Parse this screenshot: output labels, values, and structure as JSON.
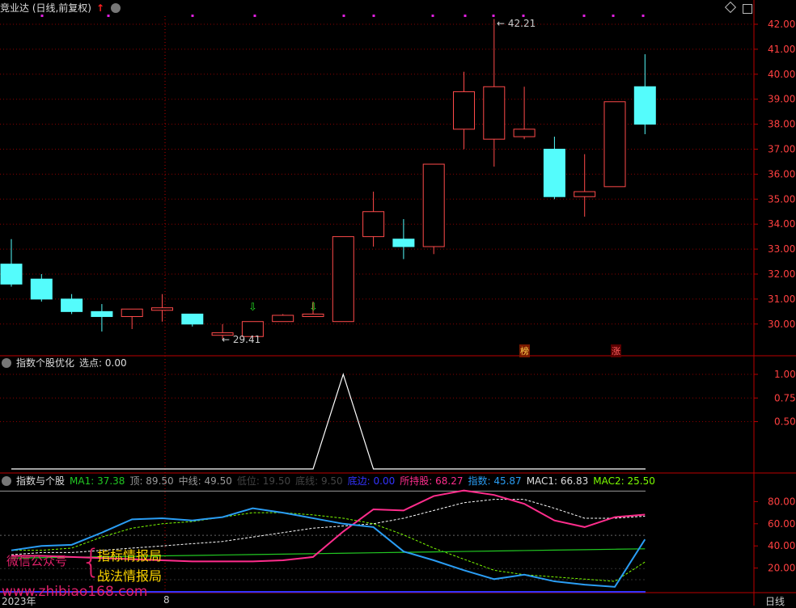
{
  "title": "竞业达 (日线,前复权)",
  "kline": {
    "ticks": [
      "42.00",
      "41.00",
      "40.00",
      "39.00",
      "38.00",
      "37.00",
      "36.00",
      "35.00",
      "34.00",
      "33.00",
      "32.00",
      "31.00",
      "30.00"
    ],
    "high_label": "42.21",
    "low_label": "29.41",
    "badge_bang": "榜",
    "badge_zhang": "涨"
  },
  "panel2": {
    "name": "指数个股优化",
    "select_label": "选点: 0.00",
    "ticks": [
      "1.00",
      "0.75",
      "0.50"
    ]
  },
  "panel3": {
    "name": "指数与个股",
    "ma1": "MA1: 37.38",
    "top": "顶: 89.50",
    "mid": "中线: 49.50",
    "low": "低位: 19.50",
    "bottom": "底线: 9.50",
    "bottom_zero": "底边: 0.00",
    "stock": "所持股: 68.27",
    "index": "指数: 45.87",
    "mac1": "MAC1: 66.83",
    "mac2": "MAC2: 25.50",
    "ticks": [
      "80.00",
      "60.00",
      "40.00",
      "20.00"
    ]
  },
  "footer": {
    "year": "2023年",
    "month": "8",
    "period": "日线"
  },
  "watermark": {
    "wechat": "微信公众号",
    "name1": "指标情报局",
    "name2": "战法情报局",
    "site": "www.zhibiao168.com"
  },
  "chart_data": {
    "type": "candlestick",
    "ylim": [
      29.0,
      42.5
    ],
    "candles": [
      {
        "o": 31.6,
        "h": 33.4,
        "l": 31.5,
        "c": 32.4,
        "up": false
      },
      {
        "o": 31.8,
        "h": 32.0,
        "l": 30.9,
        "c": 31.0,
        "up": false
      },
      {
        "o": 31.0,
        "h": 31.2,
        "l": 30.4,
        "c": 30.5,
        "up": false
      },
      {
        "o": 30.5,
        "h": 30.8,
        "l": 29.7,
        "c": 30.3,
        "up": false
      },
      {
        "o": 30.3,
        "h": 30.6,
        "l": 29.8,
        "c": 30.6,
        "up": true
      },
      {
        "o": 30.55,
        "h": 31.2,
        "l": 30.1,
        "c": 30.65,
        "up": true
      },
      {
        "o": 30.4,
        "h": 30.4,
        "l": 29.9,
        "c": 30.0,
        "up": false
      },
      {
        "o": 29.55,
        "h": 30.0,
        "l": 29.41,
        "c": 29.65,
        "up": true
      },
      {
        "o": 29.5,
        "h": 30.1,
        "l": 29.4,
        "c": 30.1,
        "up": true
      },
      {
        "o": 30.1,
        "h": 30.4,
        "l": 30.1,
        "c": 30.35,
        "up": true
      },
      {
        "o": 30.3,
        "h": 30.9,
        "l": 30.3,
        "c": 30.4,
        "up": true
      },
      {
        "o": 30.1,
        "h": 33.5,
        "l": 30.1,
        "c": 33.5,
        "up": true
      },
      {
        "o": 33.5,
        "h": 35.3,
        "l": 33.1,
        "c": 34.5,
        "up": true
      },
      {
        "o": 33.4,
        "h": 34.2,
        "l": 32.6,
        "c": 33.1,
        "up": false
      },
      {
        "o": 33.1,
        "h": 36.4,
        "l": 32.8,
        "c": 36.4,
        "up": true
      },
      {
        "o": 37.8,
        "h": 40.1,
        "l": 37.0,
        "c": 39.3,
        "up": true
      },
      {
        "o": 37.4,
        "h": 42.21,
        "l": 36.3,
        "c": 39.5,
        "up": true
      },
      {
        "o": 37.5,
        "h": 39.5,
        "l": 37.4,
        "c": 37.8,
        "up": true
      },
      {
        "o": 37.0,
        "h": 37.5,
        "l": 35.0,
        "c": 35.1,
        "up": false
      },
      {
        "o": 35.1,
        "h": 36.8,
        "l": 34.3,
        "c": 35.3,
        "up": true
      },
      {
        "o": 35.5,
        "h": 38.9,
        "l": 35.5,
        "c": 38.9,
        "up": true
      },
      {
        "o": 39.5,
        "h": 40.8,
        "l": 37.6,
        "c": 38.0,
        "up": false
      }
    ],
    "select_points": [
      0,
      0,
      0,
      0,
      0,
      0,
      0,
      0,
      0,
      0,
      0,
      0,
      0,
      0,
      0,
      0,
      0,
      0,
      0,
      0,
      0,
      0
    ],
    "stock_line": [
      31,
      31,
      30,
      29,
      28,
      27,
      26,
      26,
      26,
      27,
      30,
      53,
      73,
      72,
      85,
      90,
      86,
      78,
      63,
      57,
      66,
      68.27
    ],
    "index_line": [
      36,
      40,
      41,
      52,
      64,
      65,
      63,
      66,
      74,
      70,
      65,
      60,
      57,
      35,
      27,
      18,
      10,
      14,
      8,
      5,
      3,
      45.87
    ],
    "mac1_line": [
      32,
      34,
      34,
      36,
      38,
      40,
      42,
      44,
      48,
      52,
      56,
      58,
      60,
      65,
      72,
      79,
      82,
      82,
      74,
      65,
      65,
      66.83
    ],
    "mac2_line": [
      36,
      36,
      38,
      48,
      56,
      60,
      62,
      66,
      70,
      70,
      68,
      65,
      60,
      50,
      38,
      28,
      18,
      14,
      12,
      10,
      8,
      25.5
    ]
  }
}
